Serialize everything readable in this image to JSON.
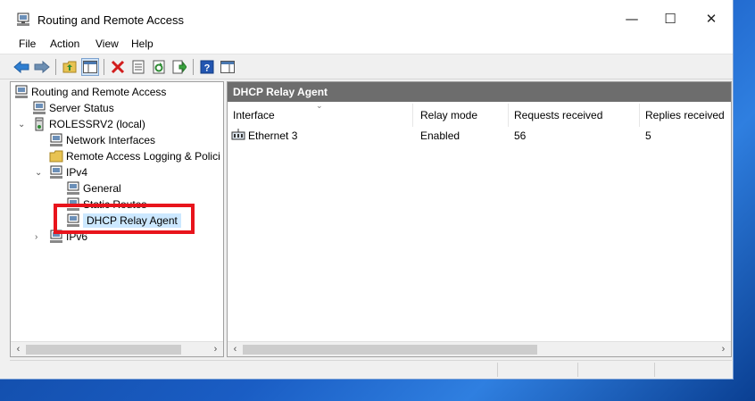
{
  "window": {
    "title": "Routing and Remote Access",
    "controls": {
      "minimize": "—",
      "maximize": "☐",
      "close": "✕"
    }
  },
  "menu": [
    "File",
    "Action",
    "View",
    "Help"
  ],
  "toolbar": {
    "icons": [
      "back-arrow-icon",
      "forward-arrow-icon",
      "up-folder-icon",
      "show-hide-tree-icon",
      "delete-icon",
      "properties-icon",
      "refresh-icon",
      "export-list-icon",
      "help-icon",
      "action-pane-icon"
    ]
  },
  "tree": {
    "root": "Routing and Remote Access",
    "items": [
      {
        "label": "Server Status"
      },
      {
        "label": "ROLESSRV2 (local)"
      },
      {
        "label": "Network Interfaces"
      },
      {
        "label": "Remote Access Logging & Polici"
      },
      {
        "label": "IPv4"
      },
      {
        "label": "General"
      },
      {
        "label": "Static Routes"
      },
      {
        "label": "DHCP Relay Agent"
      },
      {
        "label": "IPv6"
      }
    ]
  },
  "details": {
    "header": "DHCP Relay Agent",
    "columns": [
      "Interface",
      "Relay mode",
      "Requests received",
      "Replies received"
    ],
    "rows": [
      {
        "interface": "Ethernet 3",
        "relay_mode": "Enabled",
        "requests": "56",
        "replies": "5"
      }
    ]
  },
  "colors": {
    "highlight_box": "#e8141c",
    "pane_header_bg": "#6d6d6d",
    "selection_bg": "#cce8ff",
    "desktop_bg": "#1a5dc4"
  }
}
